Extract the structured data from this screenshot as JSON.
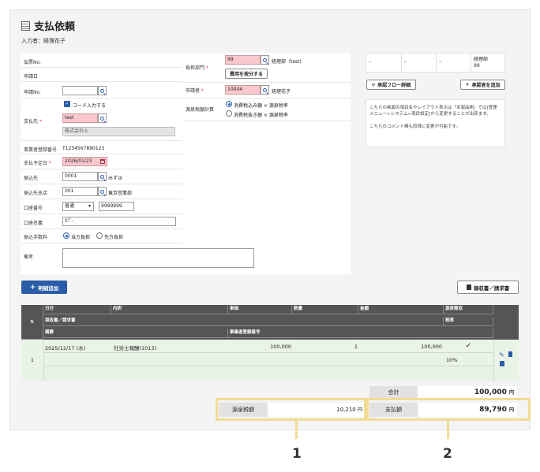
{
  "header": {
    "title": "支払依頼",
    "inputter": "入力者：経理花子"
  },
  "form": {
    "invoice_no_label": "伝票No.",
    "apply_date_label": "申請日",
    "request_no_label": "申請No.",
    "payee_label": "支払先",
    "code_input_label": "コード入力する",
    "payee_code": "test",
    "payee_name": "株式会社Ａ",
    "reg_no_label": "事業者登録番号",
    "reg_no": "T1234567890123",
    "due_date_label": "支払予定日",
    "due_date": "2026/01/23",
    "bank_label": "振込先",
    "bank_code": "0001",
    "bank_name": "みずほ",
    "branch_label": "振込先支店",
    "branch_code": "001",
    "branch_name": "東京営業部",
    "account_no_label": "口座番号",
    "account_type": "普通",
    "account_no": "9999999",
    "account_name_label": "口座名義",
    "account_name": "ｶﾌﾞ-",
    "fee_label": "振込手数料",
    "fee_opt1": "当方負担",
    "fee_opt2": "先方負担",
    "note_label": "備考",
    "dept_label": "負担部門",
    "dept_code": "99",
    "dept_name": "経理部（test)",
    "split_button": "費用を按分する",
    "applicant_label": "申請者",
    "applicant_code": "10004",
    "applicant_name": "経理花子",
    "tax_calc_label": "源泉税額計算",
    "tax_opt1": "消費税込み額 × 源泉税率",
    "tax_opt2": "消費税抜き額 × 源泉税率"
  },
  "approval": {
    "cells": [
      "–",
      "–",
      "–",
      "経理部\n99"
    ],
    "flow_button": "承認フロー詳細",
    "add_button": "承認者を追加",
    "note1": "こちらの画面の項目名やレイアウト表示は「本製品側」では[管理メニュー>システム>項目設定]から変更することが出来ます。",
    "note2": "こちらのコメント欄も同様に変更が可能です。"
  },
  "detail": {
    "add_button": "明細追加",
    "receipt_button": "領収書／請求書",
    "headers_row1": [
      "日付",
      "内訳",
      "単価",
      "数量",
      "金額",
      "源泉徴収"
    ],
    "headers_row2": [
      "領収書／請求書",
      "税率"
    ],
    "headers_row3": [
      "摘要",
      "事業者登録番号"
    ],
    "rows": [
      {
        "num": "1",
        "date": "2025/12/17 (水)",
        "item": "社労士報酬(1013)",
        "price": "100,000",
        "qty": "1",
        "amount": "100,000",
        "withholding": "✓",
        "tax_rate": "10%"
      }
    ]
  },
  "totals": {
    "total_label": "合計",
    "total_value": "100,000",
    "withholding_label": "源泉税額",
    "withholding_value": "10,210",
    "pay_label": "支払額",
    "pay_value": "89,790",
    "yen": "円"
  },
  "callouts": {
    "c1": "1",
    "c2": "2"
  },
  "colors": {
    "accent": "#2a5da8",
    "required": "#d33333",
    "highlight": "#f2dc96",
    "pink": "#f9c8ce"
  }
}
